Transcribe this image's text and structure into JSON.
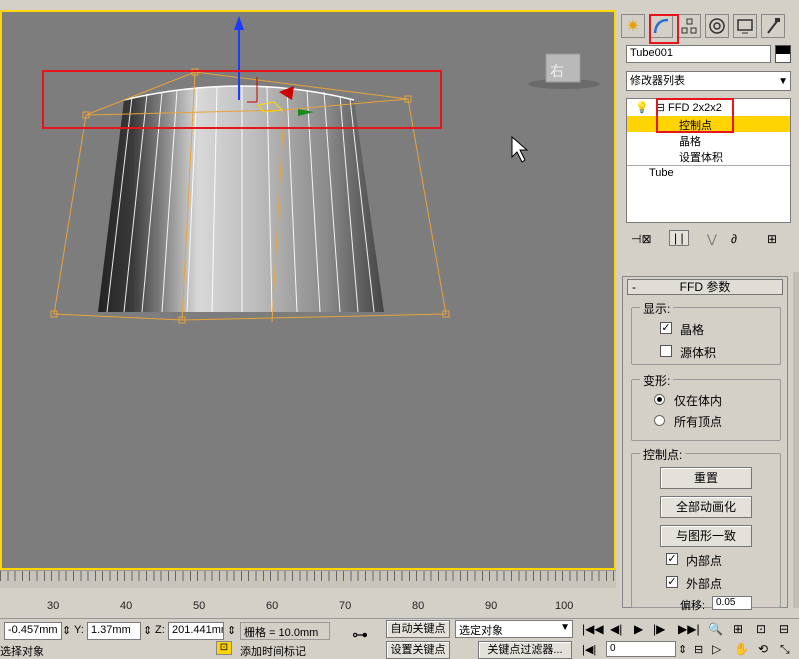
{
  "viewport": {
    "label": "右",
    "colors": {
      "border": "#ffd700",
      "background": "#7d7d7d",
      "lattice": "#e8a33a"
    }
  },
  "command_panel": {
    "tabs": [
      "sun-icon",
      "modify-icon",
      "hierarchy-icon",
      "motion-icon",
      "display-icon",
      "utilities-icon"
    ],
    "object_name": "Tube001",
    "modifier_list": "修改器列表",
    "stack": {
      "ffd": "FFD 2x2x2",
      "control_points": "控制点",
      "lattice": "晶格",
      "set_volume": "设置体积",
      "tube": "Tube"
    },
    "rollout_title": "FFD 参数",
    "display_group": "显示:",
    "chk_lattice": "晶格",
    "chk_source_volume": "源体积",
    "deform_group": "变形:",
    "radio_only_inside": "仅在体内",
    "radio_all_vertices": "所有顶点",
    "control_points_group": "控制点:",
    "btn_reset": "重置",
    "btn_animate_all": "全部动画化",
    "btn_conform": "与图形一致",
    "chk_inside_points": "内部点",
    "chk_outside_points": "外部点",
    "offset_label": "偏移:",
    "offset_value": "0.05",
    "states": {
      "lattice": true,
      "source_volume": false,
      "inside_points": true,
      "outside_points": true,
      "radio": "仅在体内"
    }
  },
  "timeline": {
    "ticks": [
      "30",
      "40",
      "50",
      "60",
      "70",
      "80",
      "90",
      "100"
    ]
  },
  "status": {
    "x_value": "-0.457mm",
    "y_label": "Y:",
    "y_value": "1.37mm",
    "z_label": "Z:",
    "z_value": "201.441mm",
    "grid": "栅格 = 10.0mm",
    "auto_key": "自动关键点",
    "set_key": "设置关键点",
    "selected_dropdown": "选定对象",
    "key_filter": "关键点过滤器...",
    "frame_value": "0",
    "prompt": "选择对象",
    "add_time_tag": "添加时间标记"
  }
}
